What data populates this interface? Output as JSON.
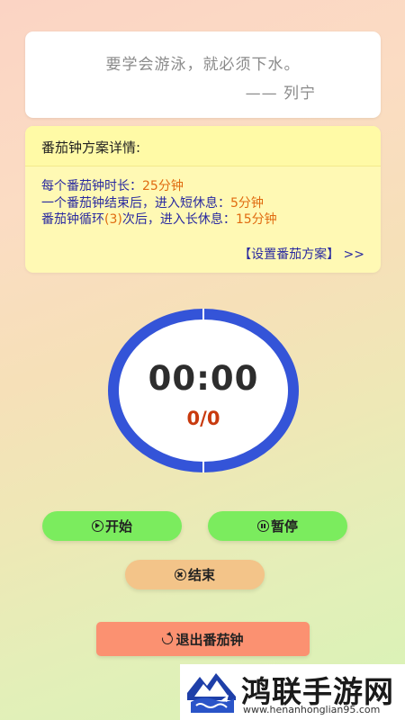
{
  "quote": {
    "text": "要学会游泳，就必须下水。",
    "author": "—— 列宁"
  },
  "plan": {
    "title": "番茄钟方案详情:",
    "line1_prefix": "每个番茄钟时长：",
    "line1_value": "25分钟",
    "line2_prefix": "一个番茄钟结束后，进入短休息：",
    "line2_value": "5分钟",
    "line3_prefix": "番茄钟循环",
    "line3_cycles": "(3)",
    "line3_middle": "次后，进入长休息：",
    "line3_value": "15分钟",
    "settings_link": "【设置番茄方案】 >>"
  },
  "timer": {
    "time": "00:00",
    "count": "0/0",
    "ring_color": "#3454d8"
  },
  "buttons": {
    "start": "开始",
    "pause": "暂停",
    "end": "结束",
    "exit": "退出番茄钟"
  },
  "icons": {
    "start": "play-circle-icon",
    "pause": "pause-circle-icon",
    "end": "close-circle-icon",
    "exit": "refresh-icon"
  },
  "watermark": {
    "title": "鸿联手游网",
    "url": "www.henanhonglian95.com"
  }
}
